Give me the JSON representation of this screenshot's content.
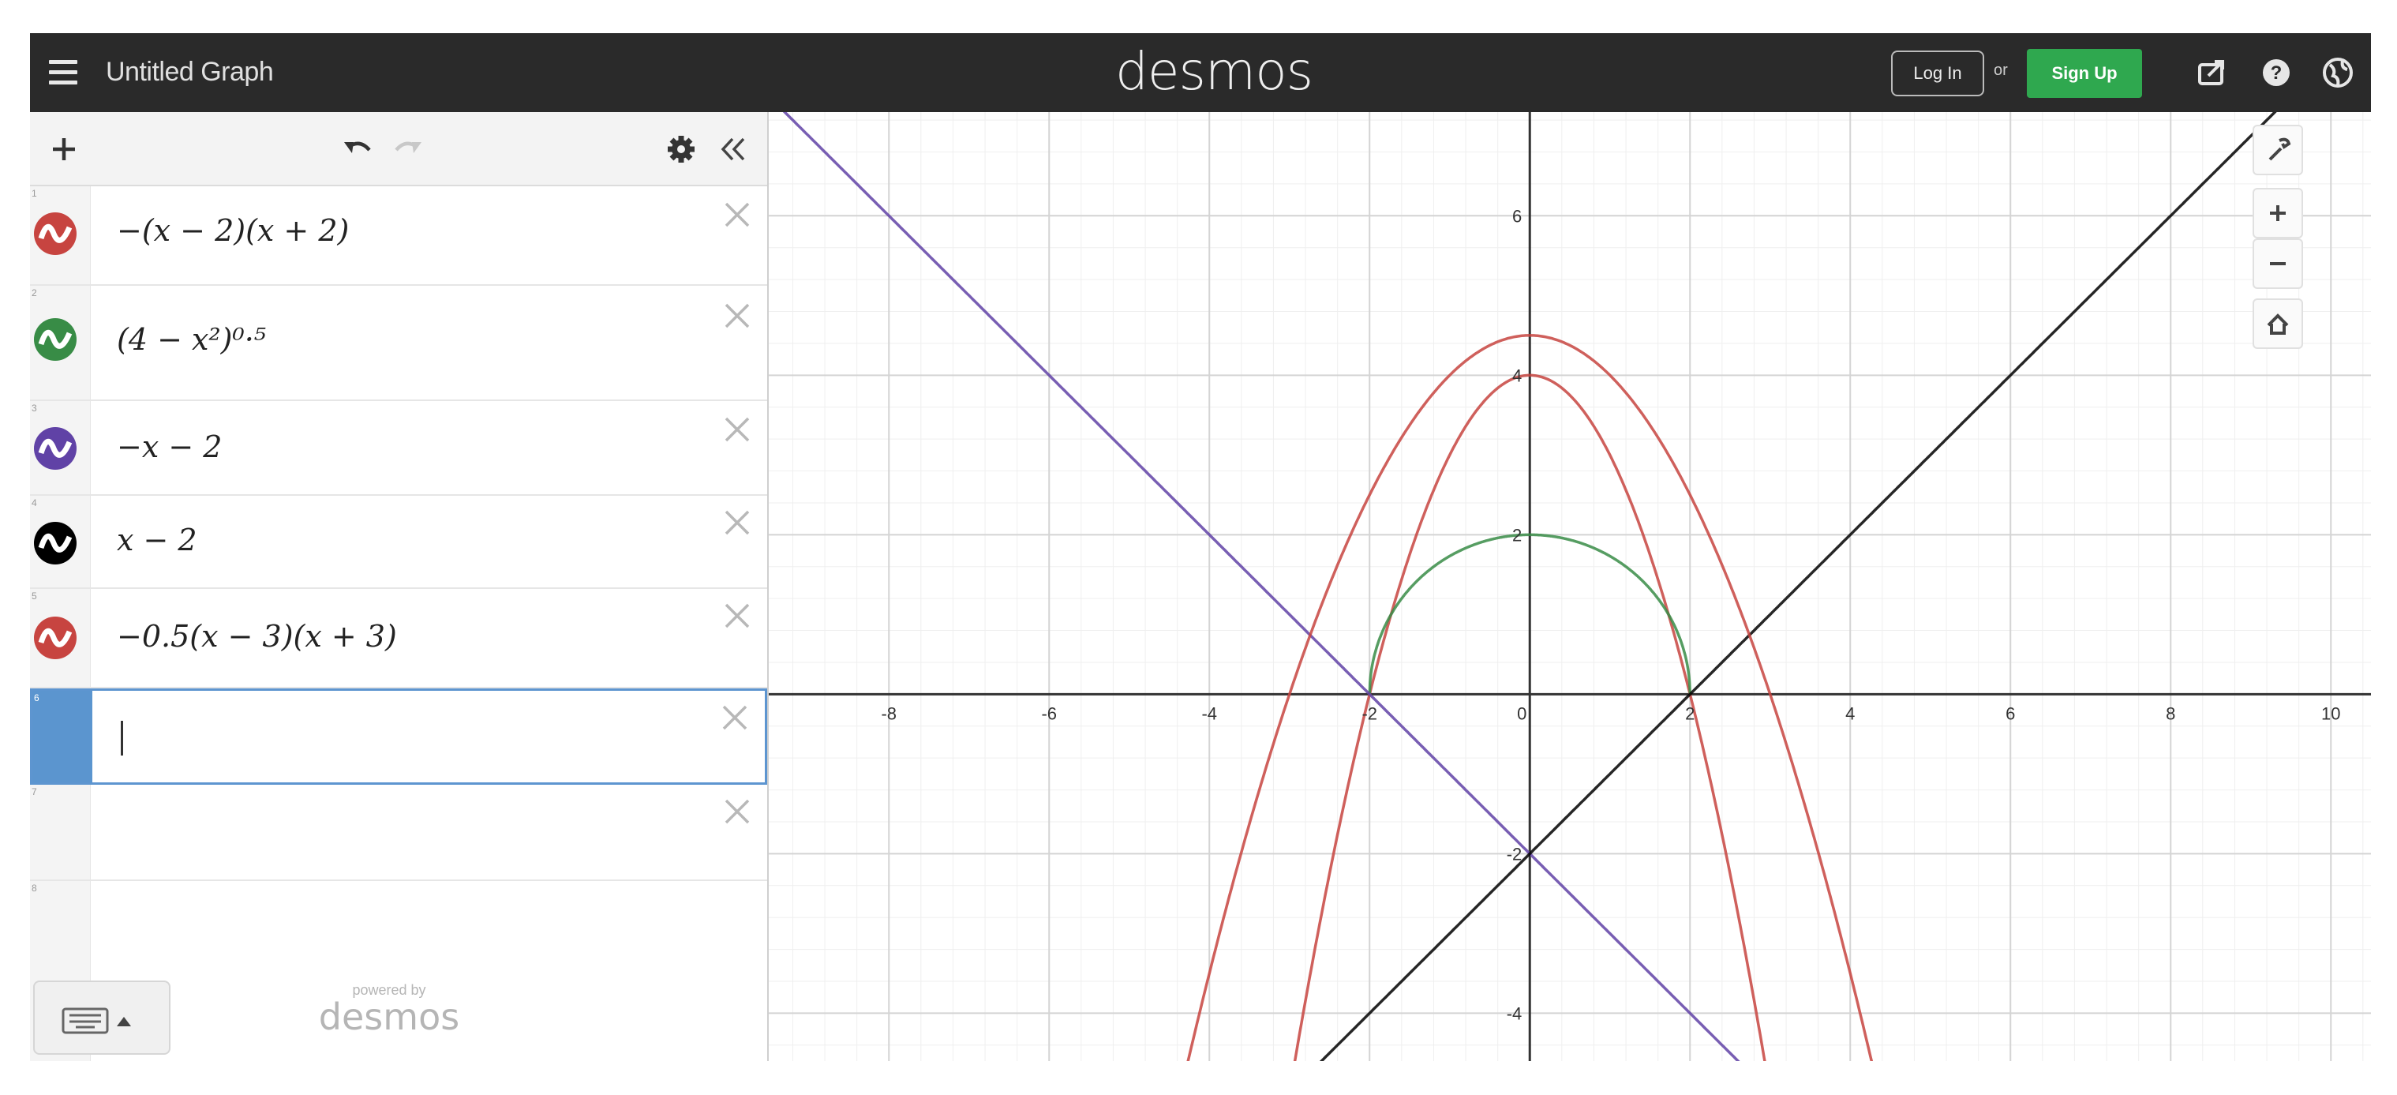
{
  "header": {
    "title": "Untitled Graph",
    "brand": "desmos",
    "login_label": "Log In",
    "or_label": "or",
    "signup_label": "Sign Up",
    "signup_color": "#2fa84f",
    "icons": [
      "share-icon",
      "help-icon",
      "language-icon"
    ]
  },
  "toolbar": {
    "icons": [
      "add-icon",
      "undo-icon",
      "redo-icon",
      "settings-icon",
      "collapse-icon"
    ]
  },
  "expressions": [
    {
      "latex": "−(x − 2)(x + 2)",
      "color": "#c74440"
    },
    {
      "latex": "(4 − x²)⁰·⁵",
      "color": "#388c46"
    },
    {
      "latex": "−x − 2",
      "color": "#6042a6"
    },
    {
      "latex": "x − 2",
      "color": "#000000"
    },
    {
      "latex": "−0.5(x − 3)(x + 3)",
      "color": "#c74440"
    },
    {
      "latex": "",
      "active": true
    },
    {
      "latex": ""
    }
  ],
  "footer": {
    "powered_by": "powered by",
    "brand": "desmos"
  },
  "graph": {
    "xmin": -9.5,
    "xmax": 10.5,
    "ymin": -4.6,
    "ymax": 7.3,
    "x_tick_labels": [
      "-8",
      "-6",
      "-4",
      "-2",
      "0",
      "2",
      "4",
      "6",
      "8",
      "10"
    ],
    "y_tick_labels": [
      "6",
      "4",
      "2",
      "-2",
      "-4"
    ],
    "axis_color": "#333333",
    "major_grid_color": "#d4d4d4",
    "minor_grid_color": "#efefef",
    "controls": [
      "wrench-icon",
      "zoom-in-icon",
      "zoom-out-icon",
      "home-icon"
    ]
  }
}
